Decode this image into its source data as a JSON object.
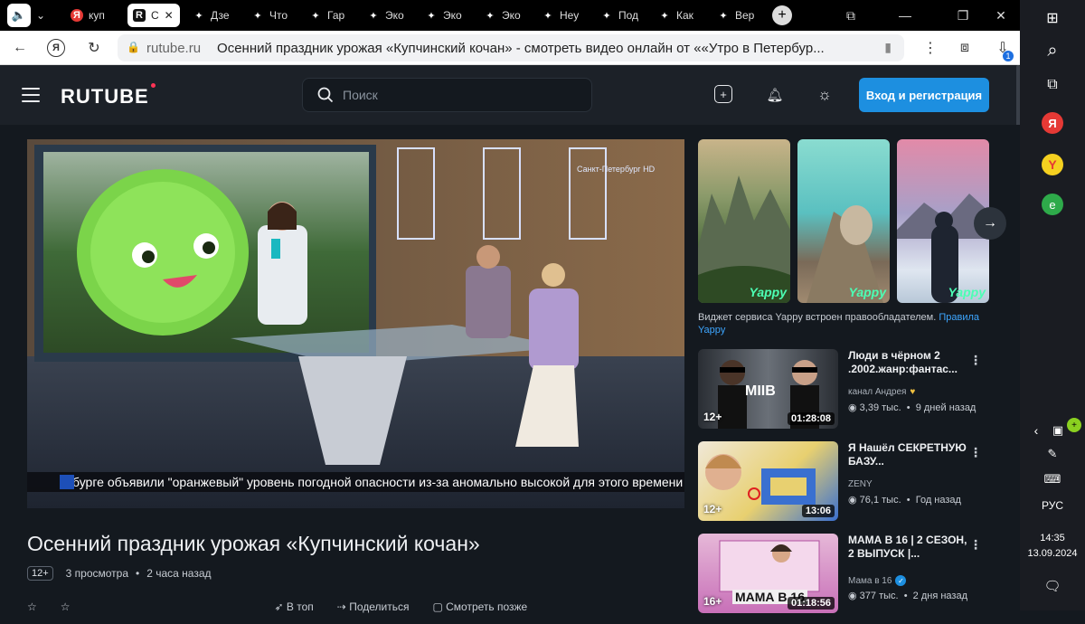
{
  "browser": {
    "tabs": [
      {
        "label": "куп",
        "icon": "yandex-icon"
      },
      {
        "label": "С",
        "icon": "rutube-icon",
        "active": true
      },
      {
        "label": "Дзе",
        "icon": "sparkle-icon"
      },
      {
        "label": "Что",
        "icon": "sparkle-icon"
      },
      {
        "label": "Гар",
        "icon": "sparkle-icon"
      },
      {
        "label": "Эко",
        "icon": "sparkle-icon"
      },
      {
        "label": "Эко",
        "icon": "sparkle-icon"
      },
      {
        "label": "Эко",
        "icon": "sparkle-icon"
      },
      {
        "label": "Неу",
        "icon": "sparkle-icon"
      },
      {
        "label": "Под",
        "icon": "sparkle-icon"
      },
      {
        "label": "Как",
        "icon": "sparkle-icon"
      },
      {
        "label": "Вер",
        "icon": "sparkle-icon"
      }
    ],
    "url_domain": "rutube.ru",
    "page_title": "Осенний праздник урожая «Купчинский кочан» - смотреть видео онлайн от ««Утро в Петербур...",
    "downloads_badge": "1"
  },
  "taskbar": {
    "lang": "РУС",
    "time": "14:35",
    "date": "13.09.2024"
  },
  "header": {
    "logo": "RUTUBE",
    "search_placeholder": "Поиск",
    "login_label": "Вход и регистрация"
  },
  "player": {
    "ticker": "бурге объявили \"оранжевый\" уровень погодной опасности из-за аномально высокой для этого времени года темпе",
    "channel_logo": "Санкт-Петербург HD"
  },
  "video": {
    "title": "Осенний праздник урожая «Купчинский кочан»",
    "age": "12+",
    "views": "3 просмотра",
    "time_ago": "2 часа назад",
    "actions": [
      "В топ",
      "Поделиться",
      "Смотреть позже"
    ]
  },
  "widget": {
    "brand": "Yappy",
    "note_text": "Виджет сервиса Yappy встроен правообладателем.",
    "note_link": "Правила Yappy"
  },
  "recommendations": [
    {
      "title": "Люди в чёрном 2 .2002.жанр:фантас...",
      "channel": "канал Андрея",
      "views": "3,39 тыс.",
      "ago": "9 дней назад",
      "duration": "01:28:08",
      "age": "12+",
      "thumb_text": "MIIB"
    },
    {
      "title": "Я Нашёл СЕКРЕТНУЮ БАЗУ...",
      "channel": "ZENY",
      "views": "76,1 тыс.",
      "ago": "Год назад",
      "duration": "13:06",
      "age": "12+",
      "thumb_text": ""
    },
    {
      "title": "МАМА В 16 | 2 СЕЗОН, 2 ВЫПУСК |...",
      "channel": "Мама в 16",
      "views": "377 тыс.",
      "ago": "2 дня назад",
      "duration": "01:18:56",
      "age": "16+",
      "thumb_text": "МАМА В 16"
    }
  ],
  "colors": {
    "accent": "#1d8fe0",
    "bg": "#14191f",
    "header": "#1c2128",
    "yappy": "#4cffb4"
  }
}
